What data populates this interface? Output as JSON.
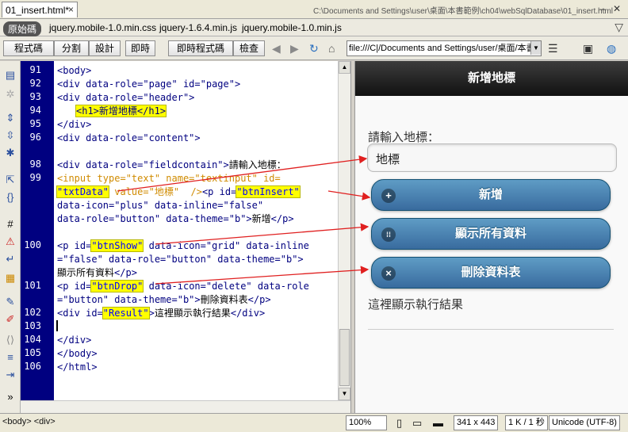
{
  "tab": {
    "filename": "01_insert.html*",
    "close": "×",
    "path": "C:\\Documents and Settings\\user\\桌面\\本書範例\\ch04\\webSqlDatabase\\01_insert.html"
  },
  "window": {
    "minimize": "–",
    "restore": "❐",
    "close": "✕"
  },
  "related": {
    "source": "原始碼",
    "files": [
      "jquery.mobile-1.0.min.css",
      "jquery-1.6.4.min.js",
      "jquery.mobile-1.0.min.js"
    ]
  },
  "toolbar": {
    "code": "程式碼",
    "split": "分割",
    "design": "設計",
    "live": "即時",
    "live_code": "即時程式碼",
    "inspect": "檢查",
    "address": "file:///C|/Documents and Settings/user/桌面/本書"
  },
  "code_lines": [
    {
      "n": "91"
    },
    {
      "n": "92"
    },
    {
      "n": "93"
    },
    {
      "n": "94"
    },
    {
      "n": "95"
    },
    {
      "n": "96"
    },
    {
      "n": "98"
    },
    {
      "n": "99"
    },
    {
      "n": "100"
    },
    {
      "n": "101"
    },
    {
      "n": "102"
    },
    {
      "n": "103"
    },
    {
      "n": "104"
    },
    {
      "n": "105"
    },
    {
      "n": "106"
    }
  ],
  "code": {
    "l91": "<body>",
    "l92a": "<div ",
    "l92b": "data-role=\"page\" ",
    "l92c": "id=\"page\">",
    "l93": "<div data-role=\"header\">",
    "l94": "<h1>新增地標</h1>",
    "l95": "</div>",
    "l96": "<div data-role=\"content\">",
    "l98a": "<div data-role=\"fieldcontain\">",
    "l98b": "請輸入地標：",
    "l99a": "<input type=\"text\" name=\"textinput\" id=",
    "l99b_hl": "\"txtData\"",
    "l99b_rest1": " value=\"地標\"  />",
    "l99b_p": "<p id=",
    "l99b_hl2": "\"btnInsert\"",
    "l99c": "data-icon=\"plus\" data-inline=\"false\"",
    "l99d": "data-role=\"button\" data-theme=\"b\">",
    "l99d_txt": "新增",
    "l99d_end": "</p>",
    "l100a": "<p id=",
    "l100a_hl": "\"btnShow\"",
    "l100a_rest": " data-icon=\"grid\" data-inline",
    "l100b": "=\"false\" data-role=\"button\" data-theme=\"b\">",
    "l100c_txt": "顯示所有資料",
    "l100c_end": "</p>",
    "l101a": "<p id=",
    "l101a_hl": "\"btnDrop\"",
    "l101a_rest": " data-icon=\"delete\" data-role",
    "l101b": "=\"button\" data-theme=\"b\">",
    "l101b_txt": "刪除資料表",
    "l101b_end": "</p>",
    "l102a": "<div id=",
    "l102a_hl": "\"Result\"",
    "l102a_rest": ">",
    "l102a_txt": "這裡顯示執行結果",
    "l102a_end": "</div>",
    "l104": "</div>",
    "l105": "</body>",
    "l106": "</html>"
  },
  "preview": {
    "header": "新增地標",
    "label": "請輸入地標：",
    "input_value": "地標",
    "btn_insert": "新增",
    "btn_show": "顯示所有資料",
    "btn_drop": "刪除資料表",
    "result": "這裡顯示執行結果",
    "icons": {
      "plus": "+",
      "grid": "⁞⁞",
      "delete": "×"
    }
  },
  "status": {
    "tags": "<body> <div>",
    "zoom": "100%",
    "size": "341 x 443",
    "download": "1 K / 1 秒",
    "encoding": "Unicode (UTF-8)"
  },
  "colors": {
    "gutter": "#000080",
    "highlight": "#ffff00",
    "button": "#396b9e",
    "arrow": "#e02020"
  }
}
